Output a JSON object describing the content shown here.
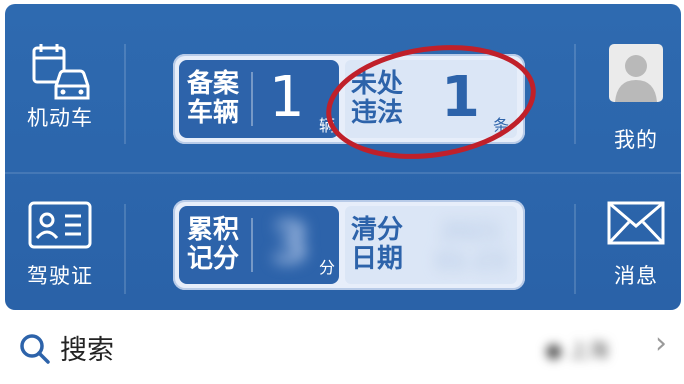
{
  "sidebar_left": {
    "vehicle_label": "机动车",
    "license_label": "驾驶证"
  },
  "sidebar_right": {
    "profile_label": "我的",
    "message_label": "消息"
  },
  "vehicle_card": {
    "registered_label_1": "备案",
    "registered_label_2": "车辆",
    "registered_count": "1",
    "registered_unit": "辆",
    "violation_label_1": "未处",
    "violation_label_2": "违法",
    "violation_count": "1",
    "violation_unit": "条"
  },
  "license_card": {
    "points_label_1": "累积",
    "points_label_2": "记分",
    "points_value": "3",
    "points_unit": "分",
    "clear_label_1": "清分",
    "clear_label_2": "日期",
    "clear_date_line1": "2021",
    "clear_date_line2": "01-23"
  },
  "search": {
    "label": "搜索",
    "location": "上海"
  },
  "colors": {
    "panel_blue": "#2e6ab0",
    "card_dark": "#2d63aa",
    "card_light": "#dbe6f6",
    "highlight_red": "#c0202a"
  }
}
